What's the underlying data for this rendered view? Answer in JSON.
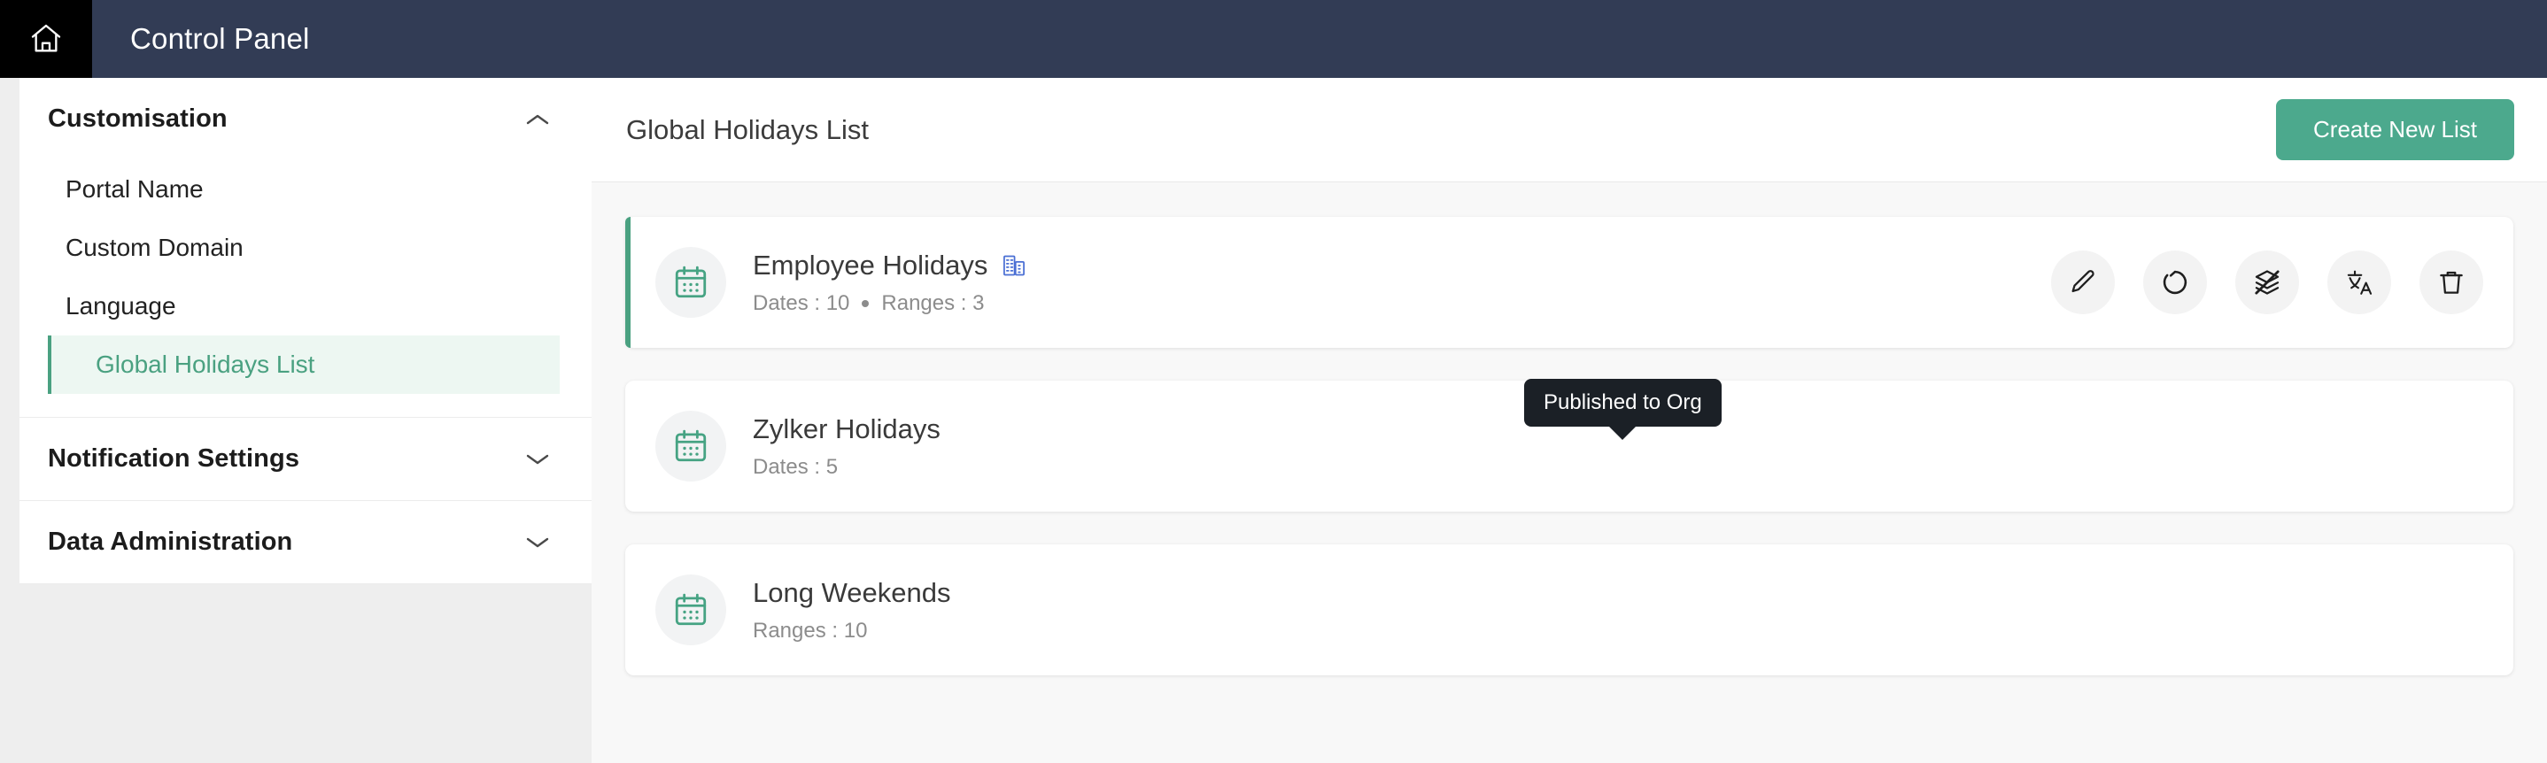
{
  "topbar": {
    "home_icon": "home-icon",
    "title": "Control Panel"
  },
  "sidebar": {
    "sections": [
      {
        "title": "Customisation",
        "chevron": "chevron-up-icon",
        "expanded": true,
        "items": [
          {
            "label": "Portal Name",
            "active": false
          },
          {
            "label": "Custom Domain",
            "active": false
          },
          {
            "label": "Language",
            "active": false
          },
          {
            "label": "Global Holidays List",
            "active": true
          }
        ]
      },
      {
        "title": "Notification Settings",
        "chevron": "chevron-down-icon",
        "expanded": false,
        "items": []
      },
      {
        "title": "Data Administration",
        "chevron": "chevron-down-icon",
        "expanded": false,
        "items": []
      }
    ]
  },
  "main": {
    "title": "Global Holidays List",
    "create_button": "Create New List",
    "tooltip": "Published to Org",
    "cards": [
      {
        "title": "Employee Holidays",
        "meta_left": "Dates : 10",
        "meta_right": "Ranges : 3",
        "selected": true,
        "published_icon": "org-building-icon",
        "actions": [
          {
            "name": "edit-button",
            "icon": "pencil-icon"
          },
          {
            "name": "refresh-button",
            "icon": "circular-arrow-icon"
          },
          {
            "name": "unpublish-button",
            "icon": "layers-off-icon"
          },
          {
            "name": "translate-button",
            "icon": "translate-icon"
          },
          {
            "name": "delete-button",
            "icon": "trash-icon"
          }
        ]
      },
      {
        "title": "Zylker Holidays",
        "meta_left": "Dates : 5",
        "meta_right": "",
        "selected": false,
        "published_icon": "",
        "actions": []
      },
      {
        "title": "Long Weekends",
        "meta_left": "Ranges : 10",
        "meta_right": "",
        "selected": false,
        "published_icon": "",
        "actions": []
      }
    ]
  },
  "colors": {
    "topbar": "#323c55",
    "accent_green": "#4ca98d",
    "active_bg": "#edf7f2",
    "org_blue": "#4a6fd4",
    "page_bg": "#f8f8f8"
  }
}
